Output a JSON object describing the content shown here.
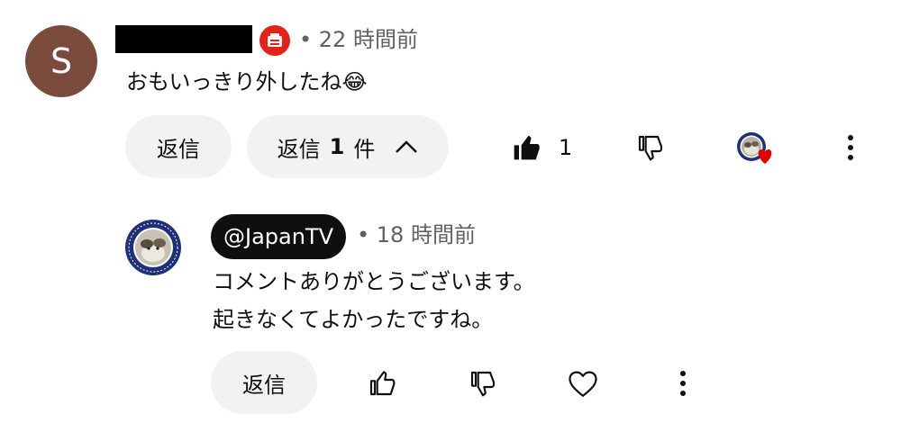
{
  "comment": {
    "avatar_letter": "S",
    "meta": "• 22 時間前",
    "text": "おもいっきり外したね😂",
    "reply_label": "返信",
    "replies_prefix": "返信",
    "replies_count": "1",
    "replies_suffix": "件",
    "like_count": "1"
  },
  "reply": {
    "channel_handle": "@JapanTV",
    "meta": "• 18 時間前",
    "text_line1": "コメントありがとうございます。",
    "text_line2": "起きなくてよかったですね。",
    "reply_label": "返信"
  },
  "colors": {
    "avatar_bg": "#7a4a3c",
    "badge_red": "#e62117",
    "heart_red": "#e00000",
    "pill_bg": "#f2f2f2",
    "meta_text": "#606060"
  },
  "icons": {
    "member_badge": "membership-badge-icon",
    "like_filled": "thumbs-up-filled-icon",
    "like_outline": "thumbs-up-outline-icon",
    "dislike": "thumbs-down-icon",
    "heart": "heart-outline-icon",
    "more": "more-vert-icon",
    "collapse": "chevron-up-icon"
  }
}
